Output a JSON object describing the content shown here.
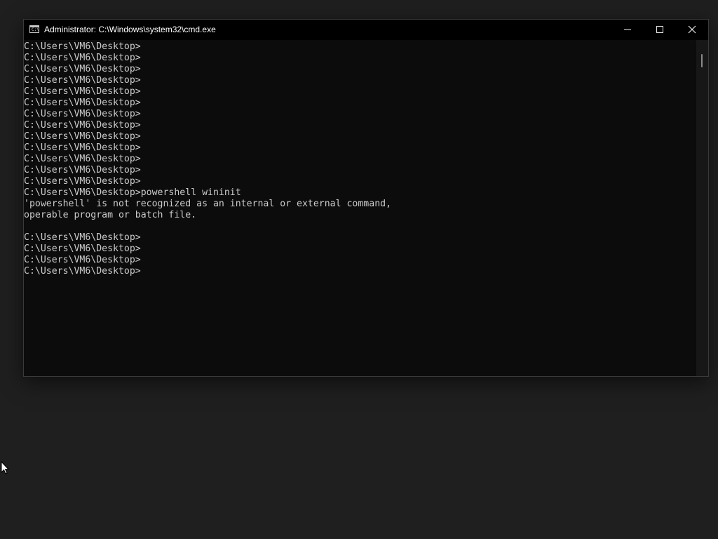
{
  "window": {
    "title": "Administrator: C:\\Windows\\system32\\cmd.exe",
    "icon": "cmd-icon",
    "icon_prompt": "C:\\",
    "controls": {
      "minimize": "minimize-icon",
      "maximize": "maximize-icon",
      "close": "close-icon"
    }
  },
  "console": {
    "lines": [
      "C:\\Users\\VM6\\Desktop>",
      "C:\\Users\\VM6\\Desktop>",
      "C:\\Users\\VM6\\Desktop>",
      "C:\\Users\\VM6\\Desktop>",
      "C:\\Users\\VM6\\Desktop>",
      "C:\\Users\\VM6\\Desktop>",
      "C:\\Users\\VM6\\Desktop>",
      "C:\\Users\\VM6\\Desktop>",
      "C:\\Users\\VM6\\Desktop>",
      "C:\\Users\\VM6\\Desktop>",
      "C:\\Users\\VM6\\Desktop>",
      "C:\\Users\\VM6\\Desktop>",
      "C:\\Users\\VM6\\Desktop>",
      "C:\\Users\\VM6\\Desktop>powershell wininit",
      "'powershell' is not recognized as an internal or external command,",
      "operable program or batch file.",
      "",
      "C:\\Users\\VM6\\Desktop>",
      "C:\\Users\\VM6\\Desktop>",
      "C:\\Users\\VM6\\Desktop>",
      "C:\\Users\\VM6\\Desktop>"
    ]
  },
  "colors": {
    "console_background": "#0c0c0c",
    "console_text": "#cccccc",
    "titlebar": "#000000",
    "desktop": "#1f1f1f"
  },
  "cursor": "mouse-pointer-icon"
}
